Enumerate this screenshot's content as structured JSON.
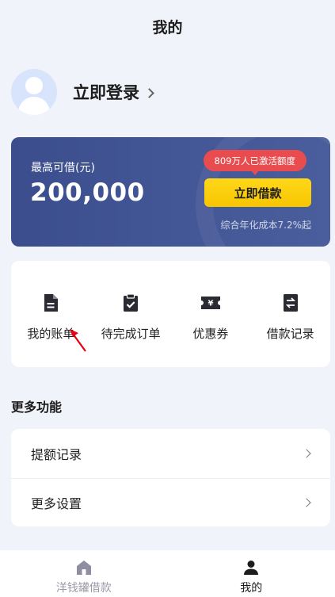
{
  "header": {
    "title": "我的"
  },
  "profile": {
    "login_text": "立即登录"
  },
  "credit": {
    "label": "最高可借(元)",
    "amount": "200,000",
    "badge": "809万人已激活额度",
    "button": "立即借款",
    "rate": "综合年化成本7.2%起"
  },
  "shortcuts": [
    {
      "label": "我的账单",
      "icon": "bill-icon"
    },
    {
      "label": "待完成订单",
      "icon": "clipboard-check-icon"
    },
    {
      "label": "优惠券",
      "icon": "coupon-icon"
    },
    {
      "label": "借款记录",
      "icon": "exchange-record-icon"
    }
  ],
  "more": {
    "title": "更多功能",
    "items": [
      {
        "label": "提额记录"
      },
      {
        "label": "更多设置"
      }
    ]
  },
  "tabbar": [
    {
      "label": "洋钱罐借款",
      "icon": "home-icon",
      "active": false
    },
    {
      "label": "我的",
      "icon": "user-icon",
      "active": true
    }
  ],
  "colors": {
    "card": "#3b4d8c",
    "button": "#ffd81a",
    "badge": "#e94c4f",
    "background": "#f1f3fa"
  }
}
